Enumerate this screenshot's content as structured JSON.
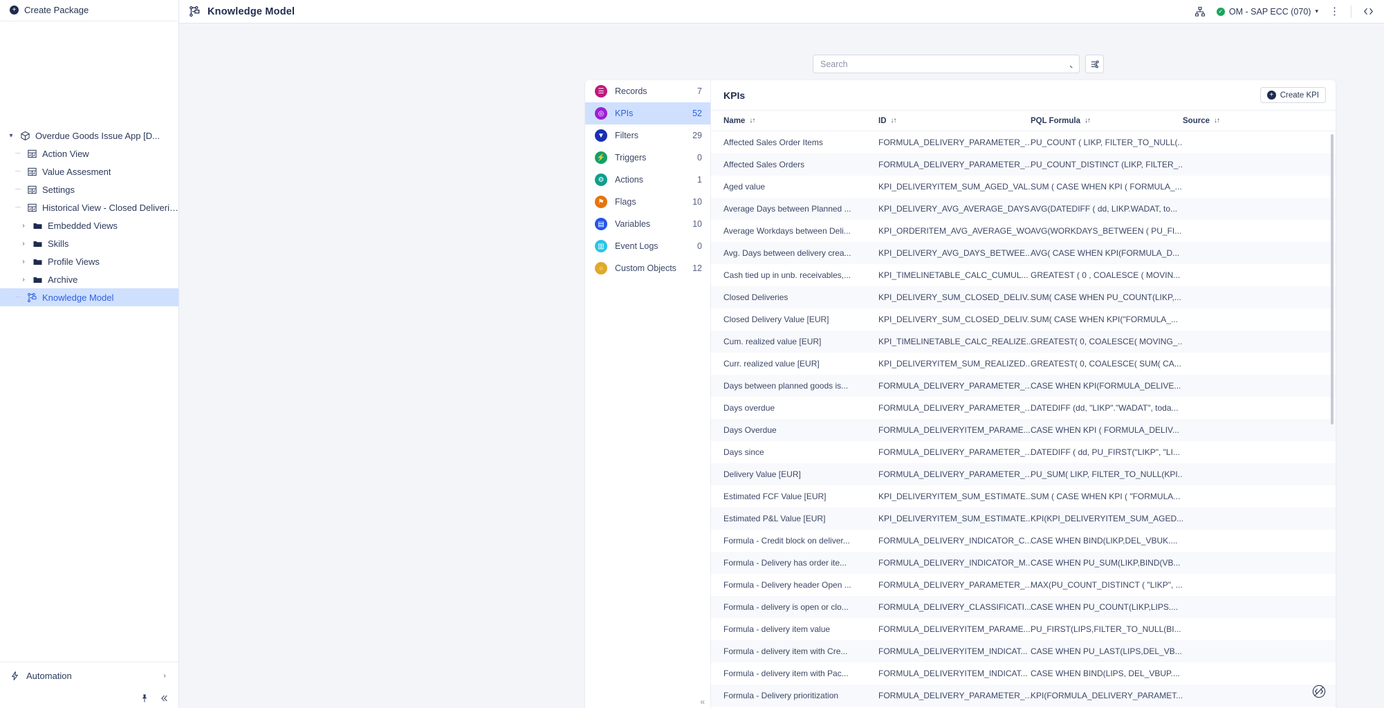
{
  "sidebar": {
    "create_package": {
      "label": "Create Package",
      "icon": "plus-circle-icon"
    },
    "tree": [
      {
        "label": "Overdue Goods Issue App [D...",
        "icon": "package-icon",
        "level": 0,
        "expander": "v",
        "selected": false
      },
      {
        "label": "Action View",
        "icon": "view-icon",
        "level": 1,
        "expander": "",
        "selected": false
      },
      {
        "label": "Value Assesment",
        "icon": "view-icon",
        "level": 1,
        "expander": "",
        "selected": false
      },
      {
        "label": "Settings",
        "icon": "view-icon",
        "level": 1,
        "expander": "",
        "selected": false
      },
      {
        "label": "Historical View - Closed Deliveries",
        "icon": "view-icon",
        "level": 1,
        "expander": "",
        "selected": false
      },
      {
        "label": "Embedded Views",
        "icon": "folder-icon",
        "level": 2,
        "expander": ">",
        "selected": false
      },
      {
        "label": "Skills",
        "icon": "folder-icon",
        "level": 2,
        "expander": ">",
        "selected": false
      },
      {
        "label": "Profile Views",
        "icon": "folder-icon",
        "level": 2,
        "expander": ">",
        "selected": false
      },
      {
        "label": "Archive",
        "icon": "folder-icon",
        "level": 2,
        "expander": ">",
        "selected": false
      },
      {
        "label": "Knowledge Model",
        "icon": "knowledge-model-icon",
        "level": 1,
        "expander": "",
        "selected": true
      }
    ],
    "automation": {
      "label": "Automation",
      "icon": "bolt-icon",
      "chevron": "›"
    },
    "footer": {
      "pin_icon": "pin-icon",
      "collapse_icon": "collapse-left-icon"
    }
  },
  "topbar": {
    "title": "Knowledge Model",
    "title_icon": "knowledge-model-icon",
    "share_icon": "org-chart-icon",
    "connection": {
      "label": "OM - SAP ECC (070)",
      "status_icon": "check-circle-icon",
      "chevron": "▾"
    },
    "more_icon": "kebab-menu-icon",
    "code_icon": "code-brackets-icon"
  },
  "search": {
    "placeholder": "Search",
    "value": "",
    "search_icon": "search-icon",
    "filter_button_icon": "filter-settings-icon"
  },
  "categories": [
    {
      "label": "Records",
      "count": "7",
      "icon": "records-icon",
      "color": "#c2187f",
      "glyph": "☰",
      "active": false
    },
    {
      "label": "KPIs",
      "count": "52",
      "icon": "kpis-icon",
      "color": "#9b1fd6",
      "glyph": "◎",
      "active": true
    },
    {
      "label": "Filters",
      "count": "29",
      "icon": "filters-icon",
      "color": "#1a2fb5",
      "glyph": "▼",
      "active": false
    },
    {
      "label": "Triggers",
      "count": "0",
      "icon": "triggers-icon",
      "color": "#12a06a",
      "glyph": "⚡",
      "active": false
    },
    {
      "label": "Actions",
      "count": "1",
      "icon": "actions-icon",
      "color": "#0f9e8e",
      "glyph": "⚙",
      "active": false
    },
    {
      "label": "Flags",
      "count": "10",
      "icon": "flags-icon",
      "color": "#e8730c",
      "glyph": "⚑",
      "active": false
    },
    {
      "label": "Variables",
      "count": "10",
      "icon": "variables-icon",
      "color": "#2356e8",
      "glyph": "▤",
      "active": false
    },
    {
      "label": "Event Logs",
      "count": "0",
      "icon": "event-logs-icon",
      "color": "#2bc4e8",
      "glyph": "▥",
      "active": false
    },
    {
      "label": "Custom Objects",
      "count": "12",
      "icon": "custom-objects-icon",
      "color": "#e0a92b",
      "glyph": "○",
      "active": false
    }
  ],
  "panel": {
    "title": "KPIs",
    "create_button": {
      "label": "Create KPI",
      "icon": "plus-circle-icon"
    },
    "collapse_icon": "collapse-left-icon",
    "columns": [
      {
        "label": "Name",
        "sort": "↓↑"
      },
      {
        "label": "ID",
        "sort": "↓↑"
      },
      {
        "label": "PQL Formula",
        "sort": "↓↑"
      },
      {
        "label": "Source",
        "sort": "↓↑"
      }
    ],
    "rows": [
      {
        "name": "Affected Sales Order Items",
        "id": "FORMULA_DELIVERY_PARAMETER_...",
        "pql": "PU_COUNT ( LIKP, FILTER_TO_NULL(...",
        "source": ""
      },
      {
        "name": "Affected Sales Orders",
        "id": "FORMULA_DELIVERY_PARAMETER_...",
        "pql": "PU_COUNT_DISTINCT (LIKP, FILTER_...",
        "source": ""
      },
      {
        "name": "Aged value",
        "id": "KPI_DELIVERYITEM_SUM_AGED_VAL...",
        "pql": "SUM ( CASE WHEN KPI ( FORMULA_...",
        "source": ""
      },
      {
        "name": "Average Days between Planned ...",
        "id": "KPI_DELIVERY_AVG_AVERAGE_DAYS...",
        "pql": "AVG(DATEDIFF ( dd, LIKP.WADAT, to...",
        "source": ""
      },
      {
        "name": "Average Workdays between Deli...",
        "id": "KPI_ORDERITEM_AVG_AVERAGE_WO...",
        "pql": "AVG(WORKDAYS_BETWEEN ( PU_FI...",
        "source": ""
      },
      {
        "name": "Avg. Days between delivery crea...",
        "id": "KPI_DELIVERY_AVG_DAYS_BETWEE...",
        "pql": "AVG( CASE WHEN KPI(FORMULA_D...",
        "source": ""
      },
      {
        "name": "Cash tied up in unb. receivables,...",
        "id": "KPI_TIMELINETABLE_CALC_CUMUL...",
        "pql": "GREATEST ( 0 , COALESCE ( MOVIN...",
        "source": ""
      },
      {
        "name": "Closed Deliveries",
        "id": "KPI_DELIVERY_SUM_CLOSED_DELIV...",
        "pql": "SUM( CASE WHEN PU_COUNT(LIKP,...",
        "source": ""
      },
      {
        "name": "Closed Delivery Value [EUR]",
        "id": "KPI_DELIVERY_SUM_CLOSED_DELIV...",
        "pql": "SUM( CASE WHEN KPI(\"FORMULA_...",
        "source": ""
      },
      {
        "name": "Cum. realized value [EUR]",
        "id": "KPI_TIMELINETABLE_CALC_REALIZE...",
        "pql": "GREATEST( 0, COALESCE( MOVING_...",
        "source": ""
      },
      {
        "name": "Curr. realized value [EUR]",
        "id": "KPI_DELIVERYITEM_SUM_REALIZED...",
        "pql": "GREATEST( 0, COALESCE( SUM( CA...",
        "source": ""
      },
      {
        "name": "Days between planned goods is...",
        "id": "FORMULA_DELIVERY_PARAMETER_...",
        "pql": "CASE WHEN KPI(FORMULA_DELIVE...",
        "source": ""
      },
      {
        "name": "Days overdue",
        "id": "FORMULA_DELIVERY_PARAMETER_...",
        "pql": "DATEDIFF (dd, \"LIKP\".\"WADAT\", toda...",
        "source": ""
      },
      {
        "name": "Days Overdue",
        "id": "FORMULA_DELIVERYITEM_PARAME...",
        "pql": "CASE WHEN KPI ( FORMULA_DELIV...",
        "source": ""
      },
      {
        "name": "Days since",
        "id": "FORMULA_DELIVERY_PARAMETER_...",
        "pql": "DATEDIFF ( dd, PU_FIRST(\"LIKP\", \"LI...",
        "source": ""
      },
      {
        "name": "Delivery Value [EUR]",
        "id": "FORMULA_DELIVERY_PARAMETER_...",
        "pql": "PU_SUM( LIKP, FILTER_TO_NULL(KPI...",
        "source": ""
      },
      {
        "name": "Estimated FCF Value [EUR]",
        "id": "KPI_DELIVERYITEM_SUM_ESTIMATE...",
        "pql": "SUM ( CASE WHEN KPI ( \"FORMULA...",
        "source": ""
      },
      {
        "name": "Estimated P&L Value [EUR]",
        "id": "KPI_DELIVERYITEM_SUM_ESTIMATE...",
        "pql": "KPI(KPI_DELIVERYITEM_SUM_AGED...",
        "source": ""
      },
      {
        "name": "Formula - Credit block on deliver...",
        "id": "FORMULA_DELIVERY_INDICATOR_C...",
        "pql": "CASE WHEN BIND(LIKP,DEL_VBUK....",
        "source": ""
      },
      {
        "name": "Formula - Delivery has order ite...",
        "id": "FORMULA_DELIVERY_INDICATOR_M...",
        "pql": "CASE WHEN PU_SUM(LIKP,BIND(VB...",
        "source": ""
      },
      {
        "name": "Formula - Delivery header Open ...",
        "id": "FORMULA_DELIVERY_PARAMETER_...",
        "pql": "MAX(PU_COUNT_DISTINCT ( \"LIKP\", ...",
        "source": ""
      },
      {
        "name": "Formula - delivery is open or clo...",
        "id": "FORMULA_DELIVERY_CLASSIFICATI...",
        "pql": "CASE WHEN PU_COUNT(LIKP,LIPS....",
        "source": ""
      },
      {
        "name": "Formula - delivery item value",
        "id": "FORMULA_DELIVERYITEM_PARAME...",
        "pql": "PU_FIRST(LIPS,FILTER_TO_NULL(BI...",
        "source": ""
      },
      {
        "name": "Formula - delivery item with Cre...",
        "id": "FORMULA_DELIVERYITEM_INDICAT...",
        "pql": "CASE WHEN PU_LAST(LIPS,DEL_VB...",
        "source": ""
      },
      {
        "name": "Formula - delivery item with Pac...",
        "id": "FORMULA_DELIVERYITEM_INDICAT...",
        "pql": "CASE WHEN BIND(LIPS, DEL_VBUP....",
        "source": ""
      },
      {
        "name": "Formula - Delivery prioritization",
        "id": "FORMULA_DELIVERY_PARAMETER_....",
        "pql": "KPI(FORMULA_DELIVERY_PARAMET...",
        "source": ""
      }
    ]
  }
}
